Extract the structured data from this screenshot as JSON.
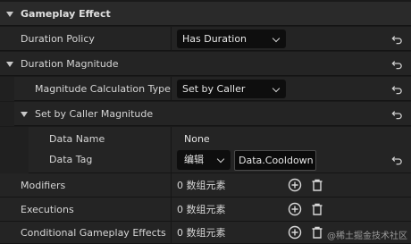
{
  "section": {
    "title": "Gameplay Effect"
  },
  "rows": {
    "duration_policy": {
      "label": "Duration Policy",
      "value": "Has Duration"
    },
    "duration_magnitude": {
      "label": "Duration Magnitude"
    },
    "magnitude_calc": {
      "label": "Magnitude Calculation Type",
      "value": "Set by Caller"
    },
    "set_by_caller": {
      "label": "Set by Caller Magnitude"
    },
    "data_name": {
      "label": "Data Name",
      "value": "None"
    },
    "data_tag": {
      "label": "Data Tag",
      "edit_label": "编辑",
      "value": "Data.Cooldown"
    },
    "modifiers": {
      "label": "Modifiers",
      "value": "0 数组元素"
    },
    "executions": {
      "label": "Executions",
      "value": "0 数组元素"
    },
    "conditional": {
      "label": "Conditional Gameplay Effects",
      "value": "0 数组元素"
    }
  },
  "watermark": "@稀土掘金技术社区",
  "icons": {
    "reset": "reset-arrow-icon",
    "add": "add-circle-icon",
    "delete": "trash-icon",
    "expand": "triangle-down-icon"
  }
}
